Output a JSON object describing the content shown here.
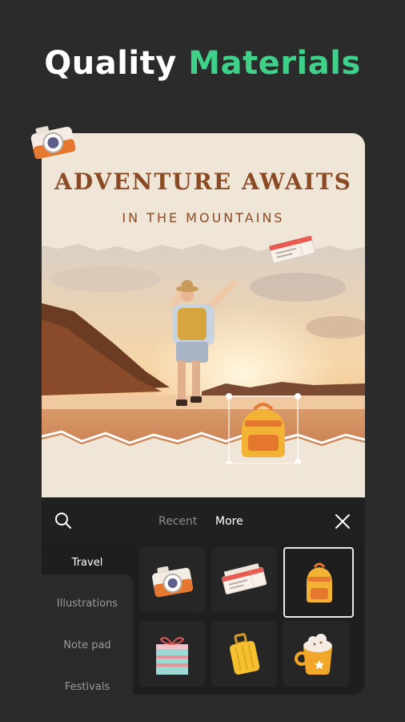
{
  "headline": {
    "word1": "Quality",
    "word2": "Materials"
  },
  "poster": {
    "title": "ADVENTURE AWAITS",
    "subtitle": "IN THE MOUNTAINS"
  },
  "panel": {
    "tabs": [
      {
        "label": "Recent",
        "active": false
      },
      {
        "label": "More",
        "active": true
      }
    ],
    "categories": [
      {
        "label": "Travel",
        "active": true
      },
      {
        "label": "Illustrations",
        "active": false
      },
      {
        "label": "Note pad",
        "active": false
      },
      {
        "label": "Festivals",
        "active": false
      }
    ],
    "stickers": [
      {
        "icon": "camera-sticker-icon",
        "selected": false
      },
      {
        "icon": "ticket-sticker-icon",
        "selected": false
      },
      {
        "icon": "backpack-sticker-icon",
        "selected": true
      },
      {
        "icon": "gift-sticker-icon",
        "selected": false
      },
      {
        "icon": "suitcase-sticker-icon",
        "selected": false
      },
      {
        "icon": "cocoa-mug-sticker-icon",
        "selected": false
      }
    ]
  },
  "colors": {
    "accent": "#3fd08a",
    "poster_text": "#8a4a24",
    "background": "#2b2b2b"
  }
}
